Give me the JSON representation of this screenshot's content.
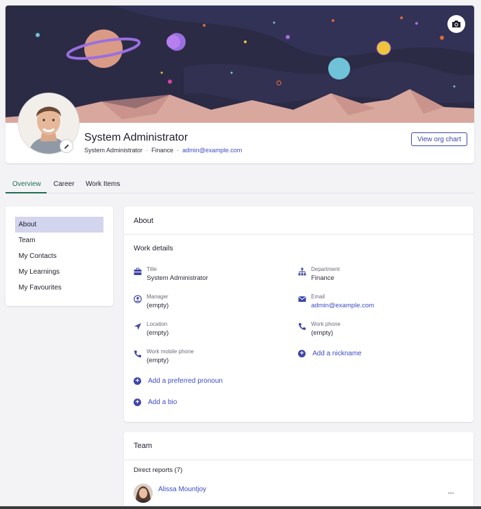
{
  "profile": {
    "name": "System Administrator",
    "meta_title": "System Administrator",
    "meta_department": "Finance",
    "meta_email": "admin@example.com",
    "separator": "·",
    "org_chart_label": "View org chart"
  },
  "icons": {
    "camera": "camera-icon",
    "edit": "pencil-icon"
  },
  "tabs": [
    {
      "label": "Overview",
      "active": true
    },
    {
      "label": "Career",
      "active": false
    },
    {
      "label": "Work Items",
      "active": false
    }
  ],
  "sidebar": {
    "items": [
      {
        "label": "About",
        "selected": true
      },
      {
        "label": "Team",
        "selected": false
      },
      {
        "label": "My Contacts",
        "selected": false
      },
      {
        "label": "My Learnings",
        "selected": false
      },
      {
        "label": "My Favourites",
        "selected": false
      }
    ]
  },
  "about": {
    "title": "About",
    "work_details_title": "Work details",
    "fields": {
      "title": {
        "label": "Title",
        "value": "System Administrator"
      },
      "department": {
        "label": "Department",
        "value": "Finance"
      },
      "manager": {
        "label": "Manager",
        "value": "(empty)"
      },
      "email": {
        "label": "Email",
        "value": "admin@example.com"
      },
      "location": {
        "label": "Location",
        "value": "(empty)"
      },
      "work_phone": {
        "label": "Work phone",
        "value": "(empty)"
      },
      "work_mobile": {
        "label": "Work mobile phone",
        "value": "(empty)"
      }
    },
    "add_nickname": "Add a nickname",
    "add_pronoun": "Add a preferred pronoun",
    "add_bio": "Add a bio"
  },
  "team": {
    "title": "Team",
    "direct_reports_label": "Direct reports (7)",
    "members": [
      {
        "name": "Alissa Mountjoy"
      }
    ],
    "more_label": "···"
  },
  "colors": {
    "accent": "#3f46a6",
    "link": "#3b4bc8",
    "tab_active": "#1f6d4e",
    "banner_bg": "#2c2b45",
    "selected_bg": "#d3d4ee"
  }
}
